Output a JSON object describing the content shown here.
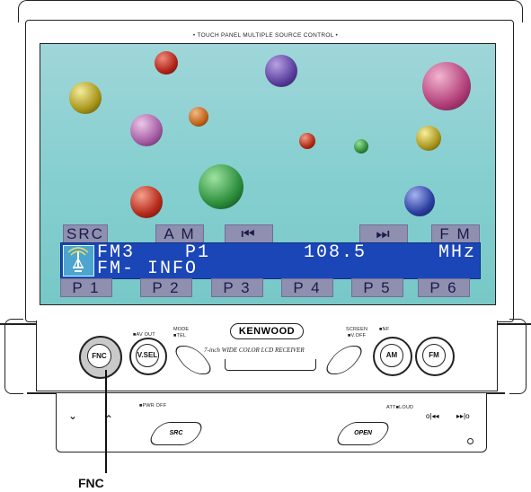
{
  "header": {
    "caption": "• TOUCH PANEL MULTIPLE SOURCE CONTROL •"
  },
  "screen": {
    "top_buttons": {
      "src": "SRC",
      "am": "A M",
      "prev": "⏮",
      "next": "⏭",
      "fm": "F M"
    },
    "display": {
      "line1_band": "FM3",
      "line1_preset": "P1",
      "line1_freq": "108.5",
      "line1_unit": "MHz",
      "line2": "FM- INFO"
    },
    "preset_buttons": [
      "P 1",
      "P 2",
      "P 3",
      "P 4",
      "P 5",
      "P 6"
    ]
  },
  "panel": {
    "brand": "KENWOOD",
    "subtitle": "7-inch WIDE COLOR LCD RECEIVER",
    "av_out": "■AV OUT",
    "mode_label": "MODE",
    "tel_label": "■TEL",
    "screen_label": "SCREEN",
    "voff_label": "■V.OFF",
    "nf_label": "■NF",
    "buttons": {
      "fnc": "FNC",
      "vsel": "V.SEL",
      "am": "AM",
      "fm": "FM"
    }
  },
  "drawer": {
    "pwr_off": "■PWR OFF",
    "src": "SRC",
    "open": "OPEN",
    "att_loud": "ATT■LOUD"
  },
  "callout": {
    "label": "FNC"
  },
  "colors": {
    "screen_bg": "#8fd3d4",
    "display_blue": "#1b46b8",
    "button_lavender": "#8f8fb0"
  }
}
